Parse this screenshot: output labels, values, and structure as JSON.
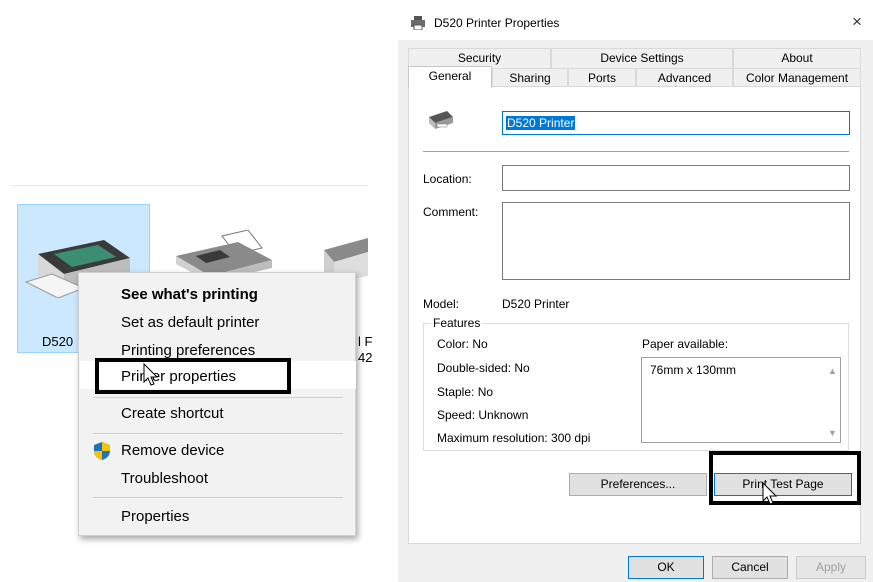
{
  "devices": {
    "items": [
      {
        "label": "D520"
      },
      {
        "label": ""
      },
      {
        "label_line1": "l F",
        "label_line2": "42"
      }
    ]
  },
  "context_menu": {
    "items": [
      {
        "label": "See what's printing",
        "bold": true
      },
      {
        "label": "Set as default printer"
      },
      {
        "label": "Printing preferences"
      },
      {
        "label": "Printer properties"
      },
      {
        "label": "Create shortcut"
      },
      {
        "label": "Remove device",
        "icon": "shield-icon"
      },
      {
        "label": "Troubleshoot"
      },
      {
        "label": "Properties"
      }
    ]
  },
  "dialog": {
    "title": "D520 Printer Properties",
    "close": "×",
    "tabs_row1": [
      "Security",
      "Device Settings",
      "About"
    ],
    "tabs_row2": [
      "General",
      "Sharing",
      "Ports",
      "Advanced",
      "Color Management"
    ],
    "printer_name": "D520 Printer",
    "location_label": "Location:",
    "location_value": "",
    "comment_label": "Comment:",
    "comment_value": "",
    "model_label": "Model:",
    "model_value": "D520 Printer",
    "features_label": "Features",
    "features": {
      "color": "Color: No",
      "double_sided": "Double-sided: No",
      "staple": "Staple: No",
      "speed": "Speed: Unknown",
      "max_resolution": "Maximum resolution: 300 dpi",
      "paper_available_label": "Paper available:",
      "paper_sizes": [
        "76mm x 130mm"
      ]
    },
    "buttons": {
      "preferences": "Preferences...",
      "print_test_page": "Print Test Page",
      "ok": "OK",
      "cancel": "Cancel",
      "apply": "Apply"
    }
  },
  "colors": {
    "selection": "#cce8ff",
    "accent": "#0078d7",
    "highlight_box": "#000000"
  }
}
